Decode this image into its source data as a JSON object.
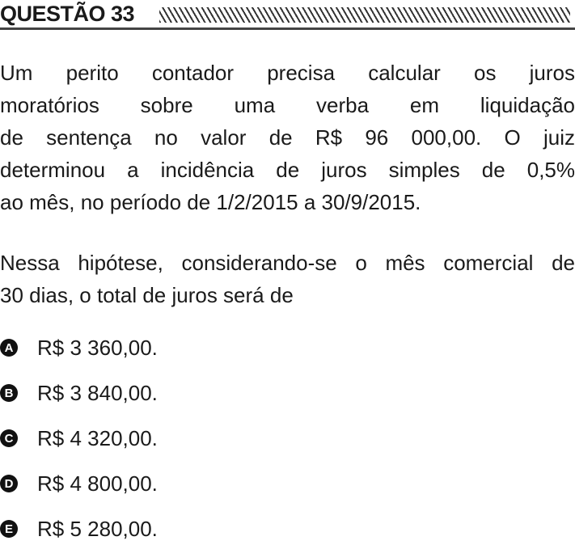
{
  "header": {
    "title": "QUESTÃO 33"
  },
  "statement": {
    "lines": [
      "Um perito contador precisa calcular os juros",
      "moratórios sobre uma verba em liquidação",
      "de sentença no valor de R$ 96 000,00. O juiz",
      "determinou a incidência de juros simples de 0,5%",
      "ao mês, no período de 1/2/2015 a 30/9/2015."
    ]
  },
  "question": {
    "lines": [
      "Nessa hipótese, considerando-se o mês comercial de",
      "30 dias, o total de juros será de"
    ]
  },
  "options": [
    {
      "letter": "A",
      "text": "R$ 3 360,00."
    },
    {
      "letter": "B",
      "text": "R$ 3 840,00."
    },
    {
      "letter": "C",
      "text": "R$ 4 320,00."
    },
    {
      "letter": "D",
      "text": "R$ 4 800,00."
    },
    {
      "letter": "E",
      "text": "R$ 5 280,00."
    }
  ]
}
